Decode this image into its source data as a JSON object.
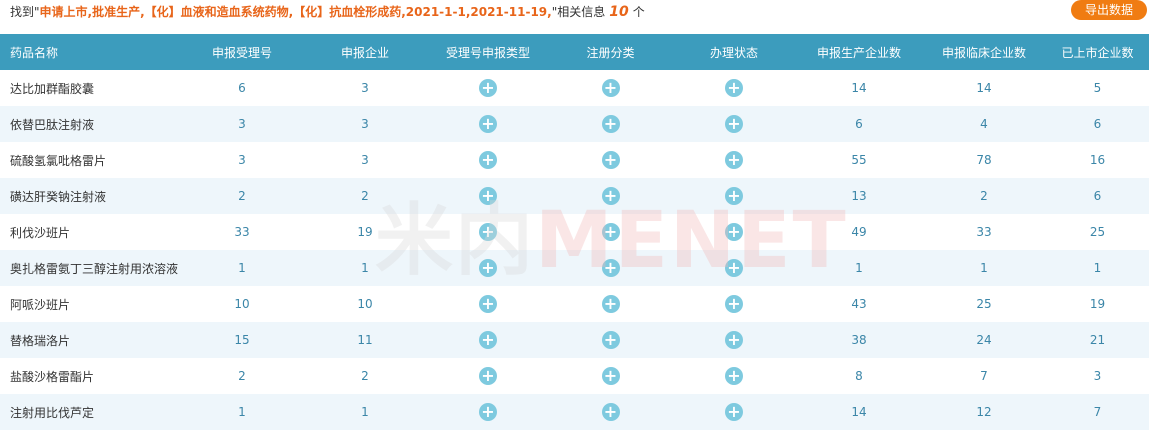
{
  "summary": {
    "prefix": "找到\"",
    "query": "申请上市,批准生产,【化】血液和造血系统药物,【化】抗血栓形成药,2021-1-1,2021-11-19,",
    "mid": "\"相关信息",
    "count": "10",
    "suffix": "个"
  },
  "export_label": "导出数据",
  "watermark": {
    "left": "米内",
    "right": "MENET"
  },
  "columns": [
    "药品名称",
    "申报受理号",
    "申报企业",
    "受理号申报类型",
    "注册分类",
    "办理状态",
    "申报生产企业数",
    "申报临床企业数",
    "已上市企业数"
  ],
  "plus_glyph": "+",
  "rows": [
    {
      "name": "达比加群酯胶囊",
      "accept": "6",
      "corp": "3",
      "prod": "14",
      "clin": "14",
      "market": "5"
    },
    {
      "name": "依替巴肽注射液",
      "accept": "3",
      "corp": "3",
      "prod": "6",
      "clin": "4",
      "market": "6"
    },
    {
      "name": "硫酸氢氯吡格雷片",
      "accept": "3",
      "corp": "3",
      "prod": "55",
      "clin": "78",
      "market": "16"
    },
    {
      "name": "磺达肝癸钠注射液",
      "accept": "2",
      "corp": "2",
      "prod": "13",
      "clin": "2",
      "market": "6"
    },
    {
      "name": "利伐沙班片",
      "accept": "33",
      "corp": "19",
      "prod": "49",
      "clin": "33",
      "market": "25"
    },
    {
      "name": "奥扎格雷氨丁三醇注射用浓溶液",
      "accept": "1",
      "corp": "1",
      "prod": "1",
      "clin": "1",
      "market": "1"
    },
    {
      "name": "阿哌沙班片",
      "accept": "10",
      "corp": "10",
      "prod": "43",
      "clin": "25",
      "market": "19"
    },
    {
      "name": "替格瑞洛片",
      "accept": "15",
      "corp": "11",
      "prod": "38",
      "clin": "24",
      "market": "21"
    },
    {
      "name": "盐酸沙格雷酯片",
      "accept": "2",
      "corp": "2",
      "prod": "8",
      "clin": "7",
      "market": "3"
    },
    {
      "name": "注射用比伐芦定",
      "accept": "1",
      "corp": "1",
      "prod": "14",
      "clin": "12",
      "market": "7"
    }
  ],
  "colors": {
    "header_bg": "#3c9cbd",
    "accent": "#f07c12",
    "row_alt": "#eef6fb",
    "plus": "#7ecadf",
    "number": "#3b86a8"
  }
}
